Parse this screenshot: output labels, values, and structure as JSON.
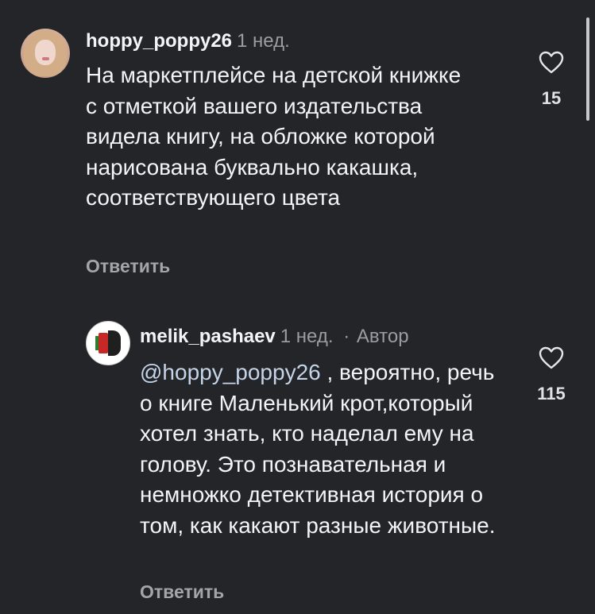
{
  "comments": [
    {
      "username": "hoppy_poppy26",
      "time": "1 нед.",
      "text": "На маркетплейсе на детской книжке с отметкой вашего издательства видела книгу, на обложке которой нарисована буквально какашка, соответствующего цвета",
      "likes": "15",
      "reply_label": "Ответить"
    },
    {
      "username": "melik_pashaev",
      "time": "1 нед.",
      "separator": "·",
      "author_badge": "Автор",
      "mention": "@hoppy_poppy26",
      "text": " , вероятно, речь о книге Маленький крот,который хотел знать, кто наделал ему на голову. Это познавательная и немножко детективная история о том, как какают разные животные.",
      "likes": "115",
      "reply_label": "Ответить"
    }
  ],
  "icons": {
    "like": "heart-outline-icon"
  },
  "colors": {
    "background": "#242529",
    "text": "#f3f4f6",
    "muted": "#9a9ca3",
    "mention": "#c5d5e9"
  }
}
